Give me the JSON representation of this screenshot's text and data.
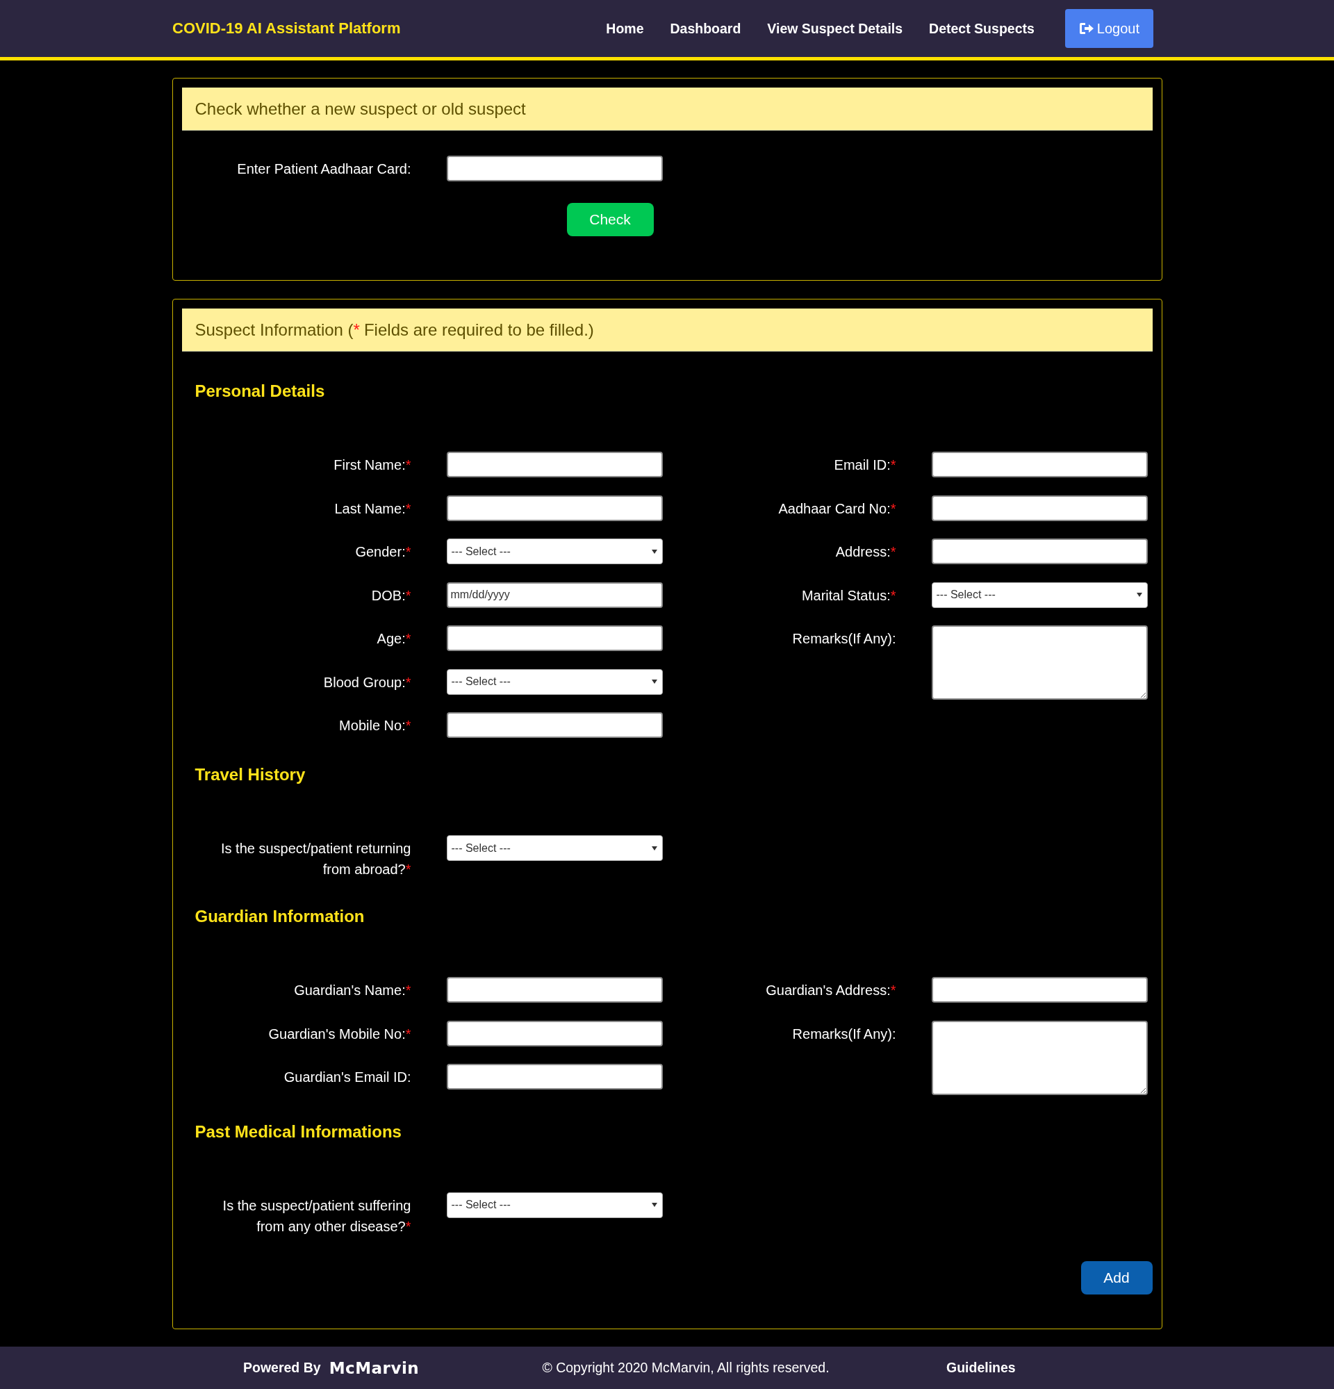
{
  "header": {
    "brand": "COVID-19 AI Assistant Platform",
    "nav": [
      {
        "label": "Home"
      },
      {
        "label": "Dashboard"
      },
      {
        "label": "View Suspect Details"
      },
      {
        "label": "Detect Suspects"
      }
    ],
    "logout": "Logout"
  },
  "check_card": {
    "title": "Check whether a new suspect or old suspect",
    "field": {
      "label": "Enter Patient Aadhaar Card:",
      "kind": "text"
    },
    "button": "Check"
  },
  "suspect_card": {
    "title": "Suspect Information (",
    "required_mark": "*",
    "title_note": "Fields are required to be filled.)",
    "sections": [
      {
        "title": "Personal Details",
        "left": [
          {
            "label": "First Name:",
            "required_mark": "*",
            "kind": "text"
          },
          {
            "label": "Last Name:",
            "required_mark": "*",
            "kind": "text"
          },
          {
            "label": "Gender:",
            "required_mark": "*",
            "kind": "select",
            "value": "--- Select ---"
          },
          {
            "label": "DOB:",
            "required_mark": "*",
            "kind": "date",
            "placeholder": "mm/dd/yyyy"
          },
          {
            "label": "Age:",
            "required_mark": "*",
            "kind": "text"
          },
          {
            "label": "Blood Group:",
            "required_mark": "*",
            "kind": "select",
            "value": "--- Select ---"
          },
          {
            "label": "Mobile No:",
            "required_mark": "*",
            "kind": "text"
          }
        ],
        "right": [
          {
            "label": "Email ID:",
            "required_mark": "*",
            "kind": "text"
          },
          {
            "label": "Aadhaar Card No:",
            "required_mark": "*",
            "kind": "text"
          },
          {
            "label": "Address:",
            "required_mark": "*",
            "kind": "text"
          },
          {
            "label": "Marital Status:",
            "required_mark": "*",
            "kind": "select",
            "value": "--- Select ---"
          },
          {
            "label": "Remarks(If Any):",
            "kind": "textarea"
          }
        ]
      },
      {
        "title": "Travel History",
        "left": [
          {
            "label": "Is the suspect/patient returning from abroad?",
            "required_mark": "*",
            "kind": "select",
            "value": "--- Select ---"
          }
        ]
      },
      {
        "title": "Guardian Information",
        "left": [
          {
            "label": "Guardian's Name:",
            "required_mark": "*",
            "kind": "text"
          },
          {
            "label": "Guardian's Mobile No:",
            "required_mark": "*",
            "kind": "text"
          },
          {
            "label": "Guardian's Email ID:",
            "kind": "text"
          }
        ],
        "right": [
          {
            "label": "Guardian's Address:",
            "required_mark": "*",
            "kind": "text"
          },
          {
            "label": "Remarks(If Any):",
            "kind": "textarea"
          }
        ]
      },
      {
        "title": "Past Medical Informations",
        "left": [
          {
            "label": "Is the suspect/patient suffering from any other disease?",
            "required_mark": "*",
            "kind": "select",
            "value": "--- Select ---"
          }
        ]
      }
    ],
    "button": "Add"
  },
  "footer": {
    "powered_by": "Powered By",
    "logo": "McMarvin",
    "copyright": "© Copyright 2020 McMarvin, All rights reserved.",
    "link": "Guidelines"
  }
}
